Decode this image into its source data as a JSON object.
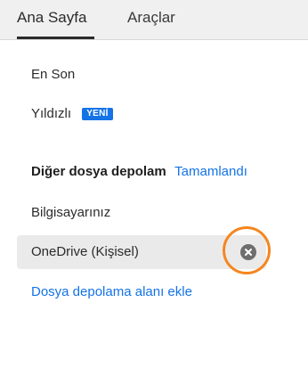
{
  "tabs": [
    {
      "label": "Ana Sayfa",
      "active": true
    },
    {
      "label": "Araçlar",
      "active": false
    }
  ],
  "nav": {
    "recent": "En Son",
    "starred": "Yıldızlı",
    "starred_badge": "YENİ"
  },
  "storage": {
    "section_title": "Diğer dosya depolama",
    "done_label": "Tamamlandı",
    "items": [
      {
        "label": "Bilgisayarınız"
      },
      {
        "label": "OneDrive (Kişisel)"
      }
    ],
    "add_label": "Dosya depolama alanı ekle"
  },
  "colors": {
    "accent": "#1473e6",
    "highlight": "#f5861f",
    "tab_bar": "#f0f0f0",
    "selected_row": "#eaeaea"
  },
  "icons": {
    "remove": "close-circle-icon"
  }
}
